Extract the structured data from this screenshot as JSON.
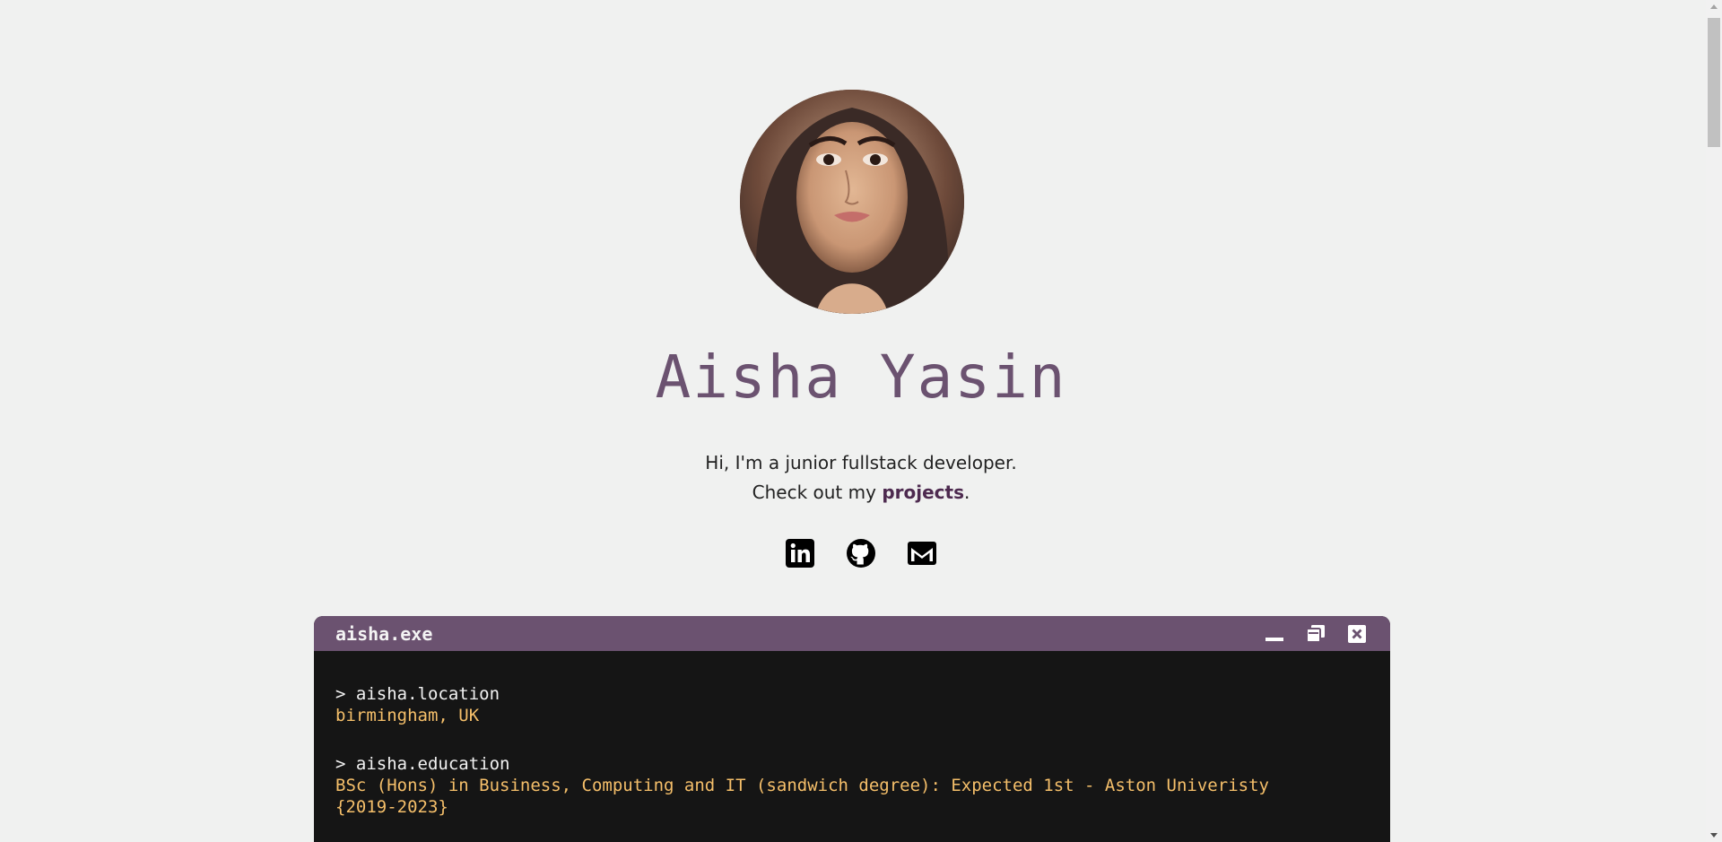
{
  "profile": {
    "name": "Aisha Yasin",
    "intro_line1": "Hi, I'm a junior fullstack developer.",
    "intro_line2_prefix": "Check out my ",
    "projects_link": "projects",
    "intro_line2_suffix": "."
  },
  "socials": [
    {
      "icon": "linkedin-icon"
    },
    {
      "icon": "github-icon"
    },
    {
      "icon": "gmail-icon"
    }
  ],
  "terminal": {
    "title": "aisha.exe",
    "controls": [
      "minimize-icon",
      "restore-icon",
      "close-icon"
    ],
    "entries": [
      {
        "command": "> aisha.location",
        "output": "birmingham, UK"
      },
      {
        "command": "> aisha.education",
        "output": "BSc (Hons) in Business, Computing and IT (sandwich degree): Expected 1st - Aston Univeristy",
        "output2": "{2019-2023}"
      }
    ]
  },
  "colors": {
    "accent": "#6b5270",
    "link": "#4d2a4f",
    "terminal_bg": "#151515",
    "terminal_output": "#f5bf6a",
    "page_bg": "#f0f1f0"
  }
}
